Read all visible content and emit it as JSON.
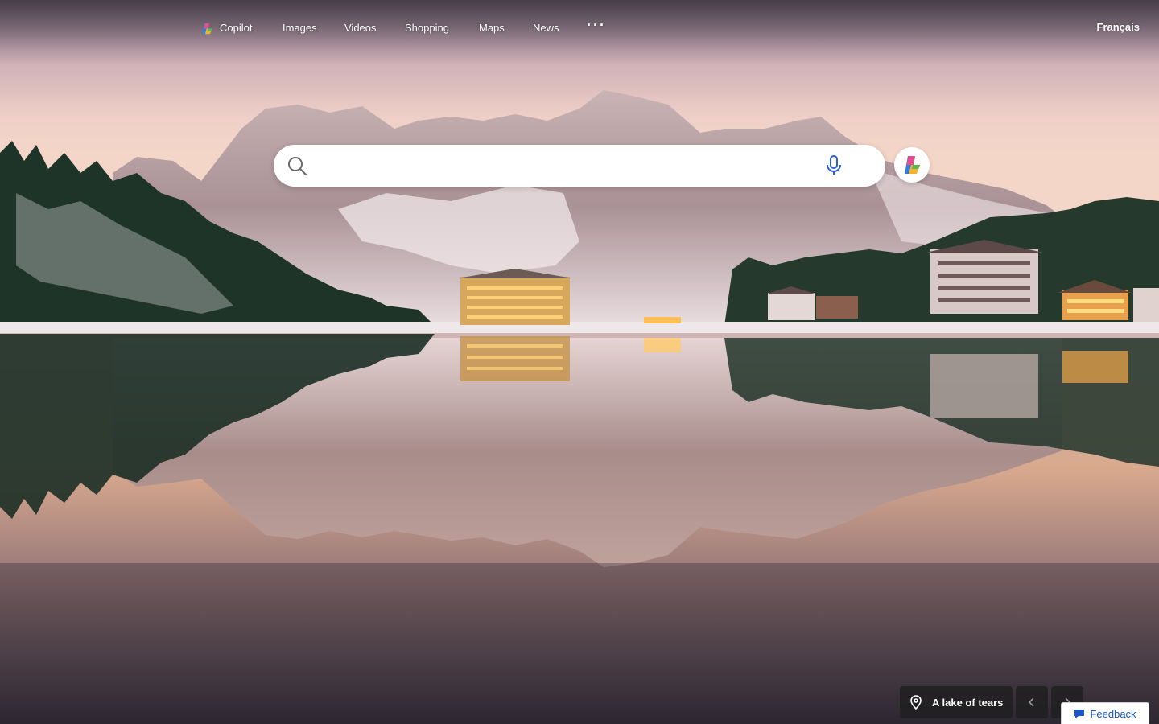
{
  "nav": {
    "items": [
      {
        "label": "Copilot",
        "icon": "copilot-logo"
      },
      {
        "label": "Images"
      },
      {
        "label": "Videos"
      },
      {
        "label": "Shopping"
      },
      {
        "label": "Maps"
      },
      {
        "label": "News"
      }
    ],
    "more_label": "···",
    "language": "Français"
  },
  "search": {
    "value": "",
    "placeholder": "",
    "search_icon": "magnifier-icon",
    "mic_icon": "microphone-icon",
    "copilot_icon": "copilot-logo"
  },
  "wallpaper": {
    "caption": "A lake of tears",
    "caption_icon": "location-pin-icon"
  },
  "controls": {
    "prev_icon": "chevron-left-icon",
    "next_icon": "chevron-right-icon"
  },
  "feedback": {
    "label": "Feedback",
    "icon": "chat-bubble-icon"
  },
  "colors": {
    "sky_top": "#a99aa6",
    "sky_glow": "#f1cfc4",
    "water_bottom": "#2d2832",
    "mic_blue": "#2b5fd9",
    "feedback_blue": "#1a56c8"
  }
}
